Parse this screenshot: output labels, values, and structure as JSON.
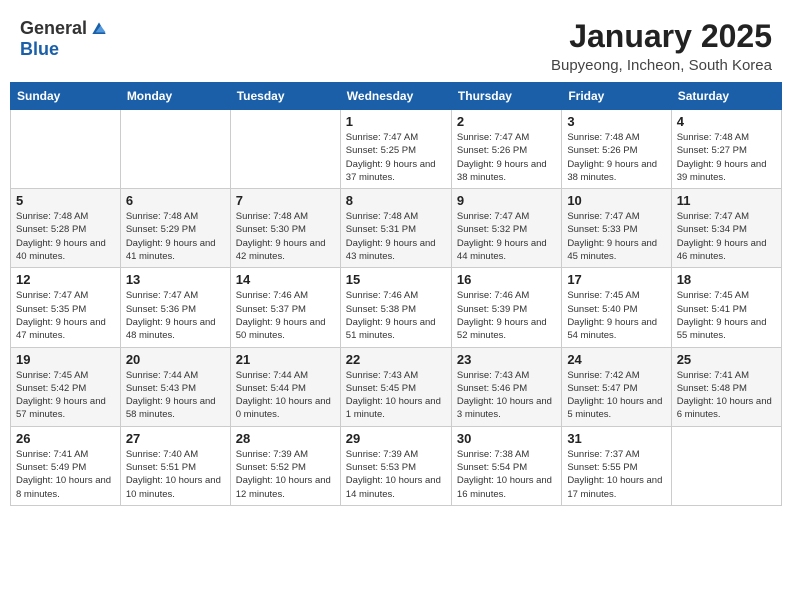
{
  "header": {
    "logo_general": "General",
    "logo_blue": "Blue",
    "month_title": "January 2025",
    "location": "Bupyeong, Incheon, South Korea"
  },
  "weekdays": [
    "Sunday",
    "Monday",
    "Tuesday",
    "Wednesday",
    "Thursday",
    "Friday",
    "Saturday"
  ],
  "weeks": [
    [
      {
        "day": "",
        "info": ""
      },
      {
        "day": "",
        "info": ""
      },
      {
        "day": "",
        "info": ""
      },
      {
        "day": "1",
        "info": "Sunrise: 7:47 AM\nSunset: 5:25 PM\nDaylight: 9 hours and 37 minutes."
      },
      {
        "day": "2",
        "info": "Sunrise: 7:47 AM\nSunset: 5:26 PM\nDaylight: 9 hours and 38 minutes."
      },
      {
        "day": "3",
        "info": "Sunrise: 7:48 AM\nSunset: 5:26 PM\nDaylight: 9 hours and 38 minutes."
      },
      {
        "day": "4",
        "info": "Sunrise: 7:48 AM\nSunset: 5:27 PM\nDaylight: 9 hours and 39 minutes."
      }
    ],
    [
      {
        "day": "5",
        "info": "Sunrise: 7:48 AM\nSunset: 5:28 PM\nDaylight: 9 hours and 40 minutes."
      },
      {
        "day": "6",
        "info": "Sunrise: 7:48 AM\nSunset: 5:29 PM\nDaylight: 9 hours and 41 minutes."
      },
      {
        "day": "7",
        "info": "Sunrise: 7:48 AM\nSunset: 5:30 PM\nDaylight: 9 hours and 42 minutes."
      },
      {
        "day": "8",
        "info": "Sunrise: 7:48 AM\nSunset: 5:31 PM\nDaylight: 9 hours and 43 minutes."
      },
      {
        "day": "9",
        "info": "Sunrise: 7:47 AM\nSunset: 5:32 PM\nDaylight: 9 hours and 44 minutes."
      },
      {
        "day": "10",
        "info": "Sunrise: 7:47 AM\nSunset: 5:33 PM\nDaylight: 9 hours and 45 minutes."
      },
      {
        "day": "11",
        "info": "Sunrise: 7:47 AM\nSunset: 5:34 PM\nDaylight: 9 hours and 46 minutes."
      }
    ],
    [
      {
        "day": "12",
        "info": "Sunrise: 7:47 AM\nSunset: 5:35 PM\nDaylight: 9 hours and 47 minutes."
      },
      {
        "day": "13",
        "info": "Sunrise: 7:47 AM\nSunset: 5:36 PM\nDaylight: 9 hours and 48 minutes."
      },
      {
        "day": "14",
        "info": "Sunrise: 7:46 AM\nSunset: 5:37 PM\nDaylight: 9 hours and 50 minutes."
      },
      {
        "day": "15",
        "info": "Sunrise: 7:46 AM\nSunset: 5:38 PM\nDaylight: 9 hours and 51 minutes."
      },
      {
        "day": "16",
        "info": "Sunrise: 7:46 AM\nSunset: 5:39 PM\nDaylight: 9 hours and 52 minutes."
      },
      {
        "day": "17",
        "info": "Sunrise: 7:45 AM\nSunset: 5:40 PM\nDaylight: 9 hours and 54 minutes."
      },
      {
        "day": "18",
        "info": "Sunrise: 7:45 AM\nSunset: 5:41 PM\nDaylight: 9 hours and 55 minutes."
      }
    ],
    [
      {
        "day": "19",
        "info": "Sunrise: 7:45 AM\nSunset: 5:42 PM\nDaylight: 9 hours and 57 minutes."
      },
      {
        "day": "20",
        "info": "Sunrise: 7:44 AM\nSunset: 5:43 PM\nDaylight: 9 hours and 58 minutes."
      },
      {
        "day": "21",
        "info": "Sunrise: 7:44 AM\nSunset: 5:44 PM\nDaylight: 10 hours and 0 minutes."
      },
      {
        "day": "22",
        "info": "Sunrise: 7:43 AM\nSunset: 5:45 PM\nDaylight: 10 hours and 1 minute."
      },
      {
        "day": "23",
        "info": "Sunrise: 7:43 AM\nSunset: 5:46 PM\nDaylight: 10 hours and 3 minutes."
      },
      {
        "day": "24",
        "info": "Sunrise: 7:42 AM\nSunset: 5:47 PM\nDaylight: 10 hours and 5 minutes."
      },
      {
        "day": "25",
        "info": "Sunrise: 7:41 AM\nSunset: 5:48 PM\nDaylight: 10 hours and 6 minutes."
      }
    ],
    [
      {
        "day": "26",
        "info": "Sunrise: 7:41 AM\nSunset: 5:49 PM\nDaylight: 10 hours and 8 minutes."
      },
      {
        "day": "27",
        "info": "Sunrise: 7:40 AM\nSunset: 5:51 PM\nDaylight: 10 hours and 10 minutes."
      },
      {
        "day": "28",
        "info": "Sunrise: 7:39 AM\nSunset: 5:52 PM\nDaylight: 10 hours and 12 minutes."
      },
      {
        "day": "29",
        "info": "Sunrise: 7:39 AM\nSunset: 5:53 PM\nDaylight: 10 hours and 14 minutes."
      },
      {
        "day": "30",
        "info": "Sunrise: 7:38 AM\nSunset: 5:54 PM\nDaylight: 10 hours and 16 minutes."
      },
      {
        "day": "31",
        "info": "Sunrise: 7:37 AM\nSunset: 5:55 PM\nDaylight: 10 hours and 17 minutes."
      },
      {
        "day": "",
        "info": ""
      }
    ]
  ]
}
